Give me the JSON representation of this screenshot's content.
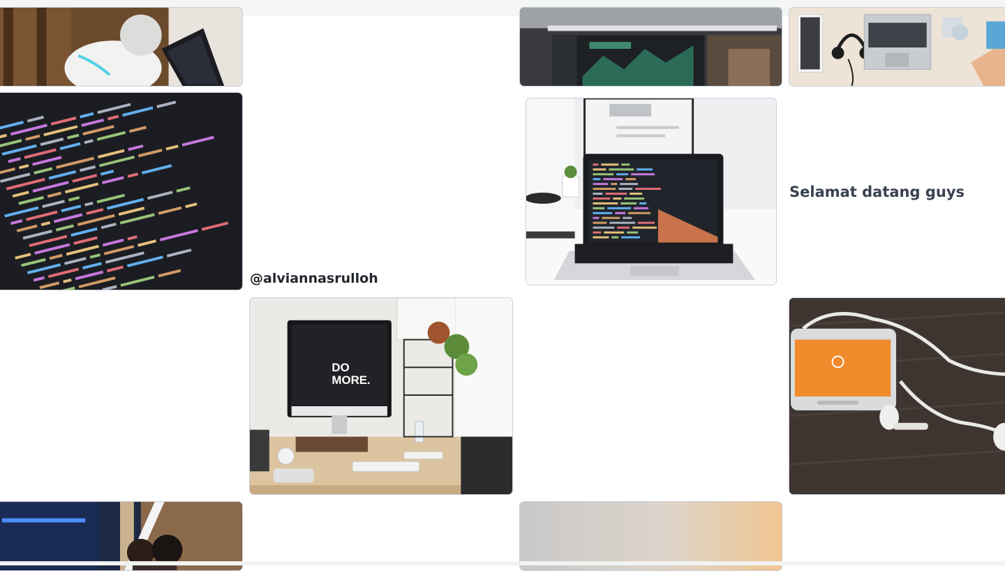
{
  "gallery": {
    "handle": "@alviannasrulloh",
    "welcome": "Selamat datang guys",
    "tiles": [
      {
        "name": "robot-photo",
        "subject": "robot"
      },
      {
        "name": "dashboard-photo",
        "subject": "analytics dashboard"
      },
      {
        "name": "desk-headphones-photo",
        "subject": "desk with headphones"
      },
      {
        "name": "code-screen-photo",
        "subject": "code on screen"
      },
      {
        "name": "laptop-code-photo",
        "subject": "laptop with code"
      },
      {
        "name": "imac-do-more-photo",
        "subject": "iMac desk",
        "screen_text": [
          "DO",
          "MORE."
        ]
      },
      {
        "name": "phone-earphones-photo",
        "subject": "phone with earphones"
      },
      {
        "name": "office-people-photo",
        "subject": "office people"
      },
      {
        "name": "gradient-photo",
        "subject": "gradient"
      }
    ]
  },
  "colors": {
    "page_background": "#ffffff",
    "caption": "#2d3340",
    "border": "#c9ced8"
  }
}
